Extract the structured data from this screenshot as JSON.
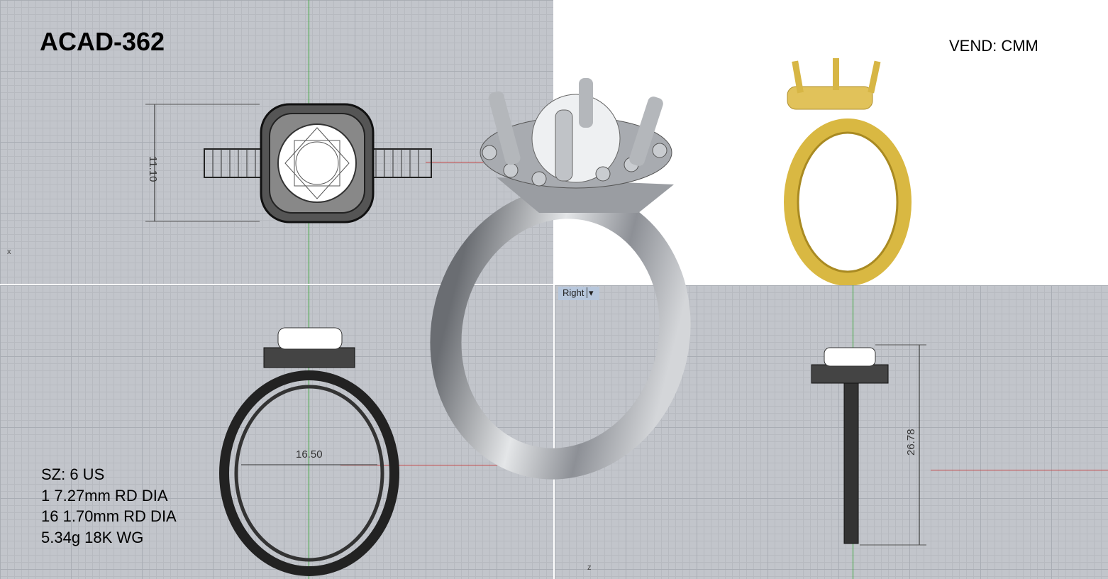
{
  "title": "ACAD-362",
  "vendor": "VEND: CMM",
  "specs": [
    "SZ: 6 US",
    "1 7.27mm RD DIA",
    "16 1.70mm RD DIA",
    "5.34g 18K WG"
  ],
  "dimensions": {
    "top_height": "11.10",
    "front_width": "16.50",
    "side_height": "26.78"
  },
  "viewports": {
    "right_label": "Right",
    "right_dropdown": "▾",
    "top_axis": "x",
    "right_axis": "z"
  },
  "colors": {
    "metal_white": "#b9bcc0",
    "metal_yellow": "#d9b842",
    "grid": "#c2c5cb"
  }
}
